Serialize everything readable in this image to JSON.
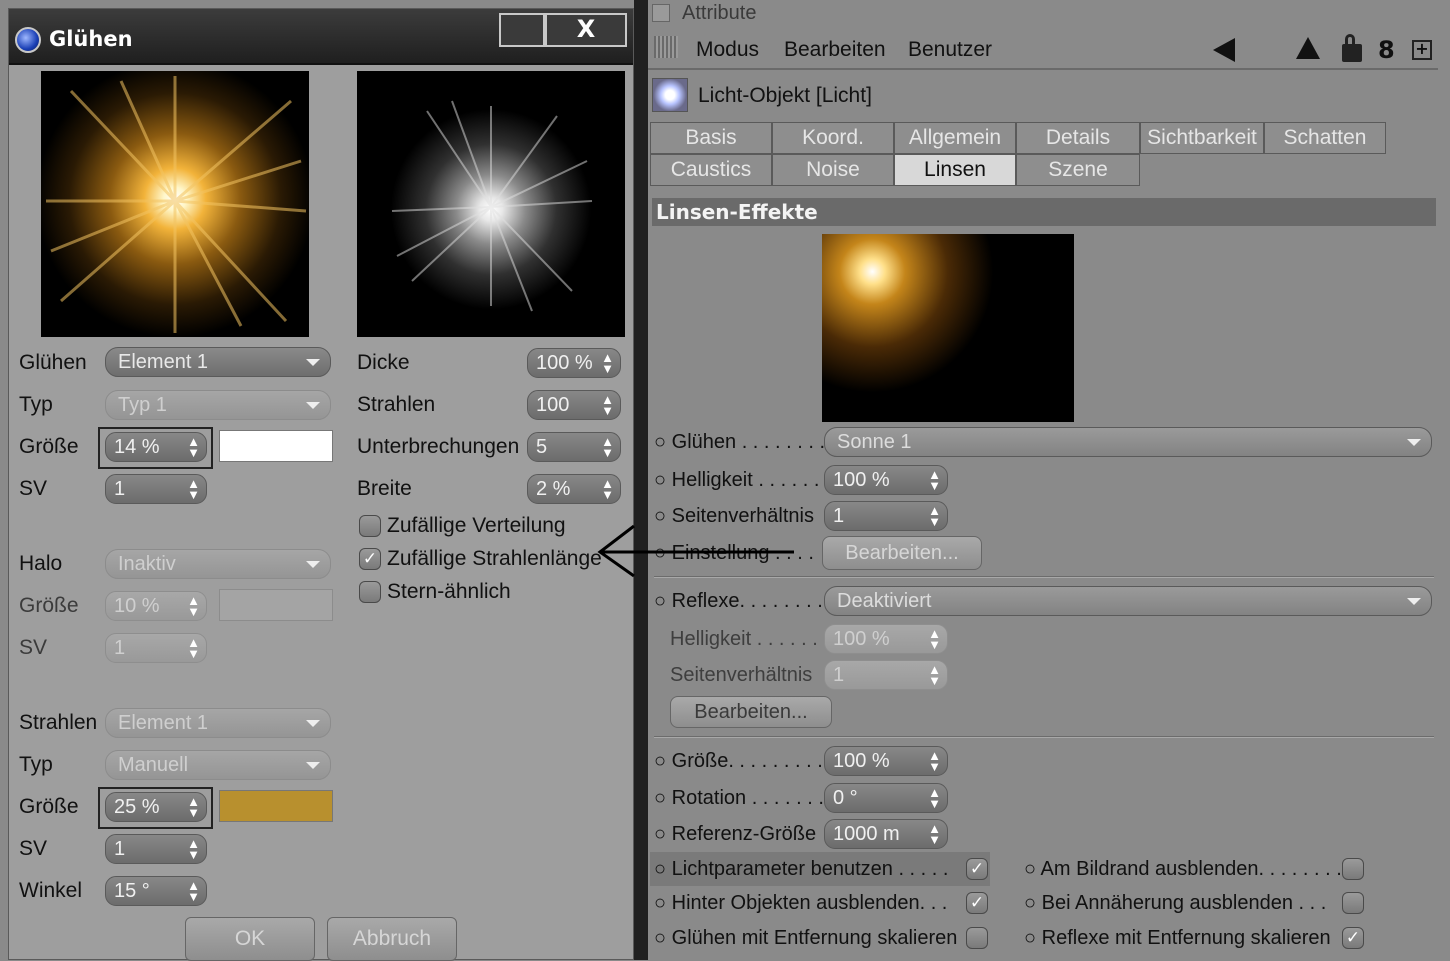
{
  "dialog": {
    "title": "Glühen",
    "close_label": "X",
    "left": {
      "gluehen_label": "Glühen",
      "gluehen_value": "Element 1",
      "typ_label": "Typ",
      "typ_value": "Typ 1",
      "groesse_label": "Größe",
      "groesse_value": "14 %",
      "sv_label": "SV",
      "sv_value": "1",
      "halo_label": "Halo",
      "halo_value": "Inaktiv",
      "halo_groesse_label": "Größe",
      "halo_groesse_value": "10 %",
      "halo_sv_label": "SV",
      "halo_sv_value": "1",
      "strahlen_label": "Strahlen",
      "strahlen_value": "Element 1",
      "strahlen_typ_label": "Typ",
      "strahlen_typ_value": "Manuell",
      "strahlen_groesse_label": "Größe",
      "strahlen_groesse_value": "25 %",
      "strahlen_sv_label": "SV",
      "strahlen_sv_value": "1",
      "winkel_label": "Winkel",
      "winkel_value": "15 °"
    },
    "right": {
      "dicke_label": "Dicke",
      "dicke_value": "100 %",
      "strahlen_label": "Strahlen",
      "strahlen_value": "100",
      "unterbrechungen_label": "Unterbrechungen",
      "unterbrechungen_value": "5",
      "breite_label": "Breite",
      "breite_value": "2 %",
      "cb1": "Zufällige Verteilung",
      "cb2": "Zufällige Strahlenlänge",
      "cb3": "Stern-ähnlich"
    },
    "ok_label": "OK",
    "cancel_label": "Abbruch",
    "colors": {
      "glow_color": "#ffffff",
      "rays_color": "#b8902e"
    }
  },
  "attr": {
    "header": "Attribute",
    "menu": [
      "Modus",
      "Bearbeiten",
      "Benutzer"
    ],
    "object_title": "Licht-Objekt [Licht]",
    "tabs_row1": [
      "Basis",
      "Koord.",
      "Allgemein",
      "Details",
      "Sichtbarkeit",
      "Schatten"
    ],
    "tabs_row2": [
      "Caustics",
      "Noise",
      "Linsen",
      "Szene"
    ],
    "section": "Linsen-Effekte",
    "gluehen_label": "Glühen . . . . . . . .",
    "gluehen_value": "Sonne 1",
    "helligkeit_label": "Helligkeit . . . . . .",
    "helligkeit_value": "100 %",
    "seiten_label": "Seitenverhältnis",
    "seiten_value": "1",
    "einstellung_label": "Einstellung . . . .",
    "einstellung_btn": "Bearbeiten...",
    "reflexe_label": "Reflexe. . . . . . . .",
    "reflexe_value": "Deaktiviert",
    "r_hell_label": "Helligkeit . . . . . .",
    "r_hell_value": "100 %",
    "r_seiten_label": "Seitenverhältnis",
    "r_seiten_value": "1",
    "r_btn": "Bearbeiten...",
    "groesse_label": "Größe. . . . . . . . .",
    "groesse_value": "100 %",
    "rotation_label": "Rotation . . . . . . .",
    "rotation_value": "0 °",
    "ref_label": "Referenz-Größe",
    "ref_value": "1000 m",
    "cb_licht": "Lichtparameter benutzen . . . . .",
    "cb_hinter": "Hinter Objekten ausblenden. . .",
    "cb_gluehen_entf": "Glühen mit Entfernung skalieren",
    "cb_bildrand": "Am Bildrand ausblenden. . . . . . . .",
    "cb_annaeherung": "Bei Annäherung ausblenden . . .",
    "cb_reflexe_entf": "Reflexe mit Entfernung skalieren"
  }
}
